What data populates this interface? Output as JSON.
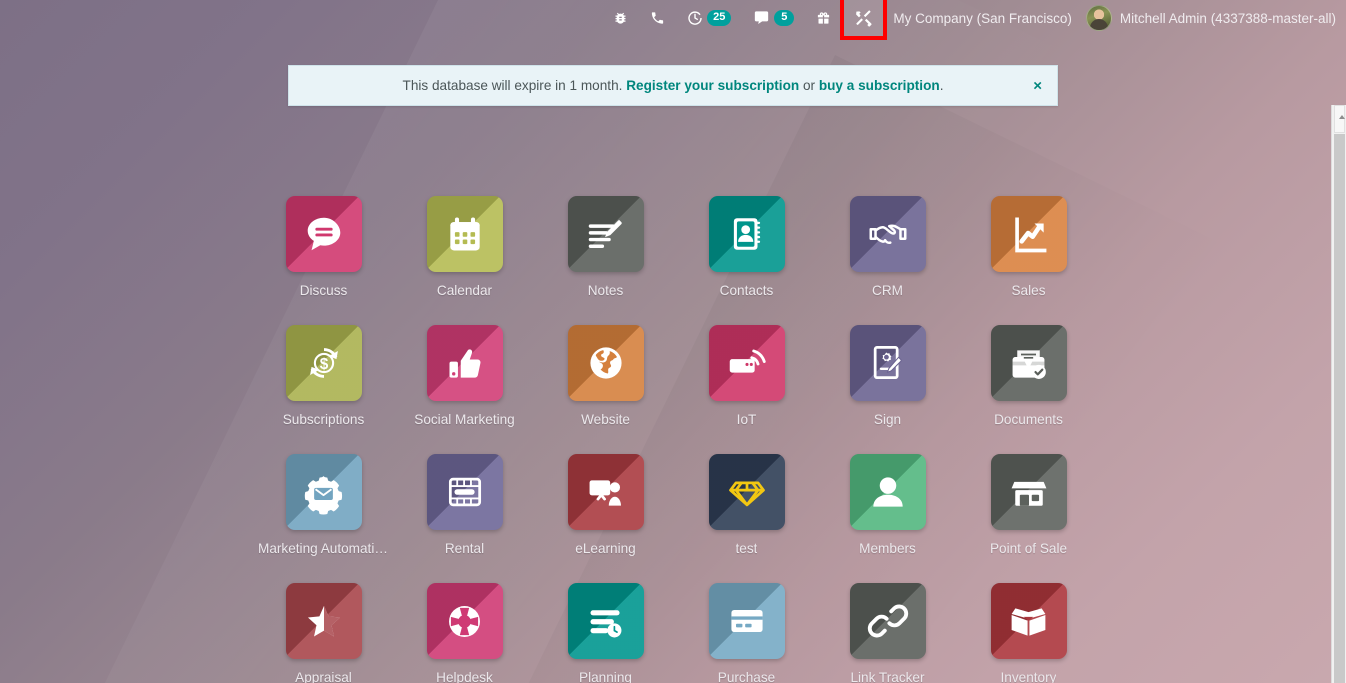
{
  "topbar": {
    "systray": [
      {
        "name": "bug-icon",
        "icon": "bug",
        "badge": null
      },
      {
        "name": "phone-icon",
        "icon": "phone",
        "badge": null
      },
      {
        "name": "activities-icon",
        "icon": "clock",
        "badge": "25"
      },
      {
        "name": "messages-icon",
        "icon": "comment",
        "badge": "5"
      },
      {
        "name": "gift-icon",
        "icon": "gift",
        "badge": null
      },
      {
        "name": "tools-icon",
        "icon": "tools",
        "badge": null,
        "highlighted": true
      }
    ],
    "company": "My Company (San Francisco)",
    "user": "Mitchell Admin (4337388-master-all)"
  },
  "banner": {
    "lead": "This database will expire in 1 month.",
    "link1": "Register your subscription",
    "middle": " or ",
    "link2": "buy a subscription",
    "tail": ".",
    "close": "×",
    "link_color": "#00867d"
  },
  "apps": [
    {
      "label": "Discuss",
      "icon": "discuss",
      "color": "#d0386e"
    },
    {
      "label": "Calendar",
      "icon": "calendar",
      "color": "#b4bb52"
    },
    {
      "label": "Notes",
      "icon": "notes",
      "color": "#5a5f5a"
    },
    {
      "label": "Contacts",
      "icon": "contacts",
      "color": "#00958c"
    },
    {
      "label": "CRM",
      "icon": "crm",
      "color": "#6b6391"
    },
    {
      "label": "Sales",
      "icon": "sales",
      "color": "#d9813f"
    },
    {
      "label": "Subscriptions",
      "icon": "subscriptions",
      "color": "#aab14f"
    },
    {
      "label": "Social Marketing",
      "icon": "social",
      "color": "#d13d76"
    },
    {
      "label": "Website",
      "icon": "website",
      "color": "#d5803d"
    },
    {
      "label": "IoT",
      "icon": "iot",
      "color": "#cf3668"
    },
    {
      "label": "Sign",
      "icon": "sign",
      "color": "#6b6391"
    },
    {
      "label": "Documents",
      "icon": "documents",
      "color": "#5a5f5a"
    },
    {
      "label": "Marketing Automation",
      "icon": "marketing-automation",
      "color": "#72a4c0"
    },
    {
      "label": "Rental",
      "icon": "rental",
      "color": "#6d6697"
    },
    {
      "label": "eLearning",
      "icon": "elearning",
      "color": "#a93a40"
    },
    {
      "label": "test",
      "icon": "diamond",
      "color": "#2e3d55"
    },
    {
      "label": "Members",
      "icon": "members",
      "color": "#52b77f"
    },
    {
      "label": "Point of Sale",
      "icon": "pos",
      "color": "#5d625d"
    },
    {
      "label": "Appraisal",
      "icon": "appraisal",
      "color": "#a8454b"
    },
    {
      "label": "Helpdesk",
      "icon": "helpdesk",
      "color": "#cf3a74"
    },
    {
      "label": "Planning",
      "icon": "planning",
      "color": "#00968e"
    },
    {
      "label": "Purchase",
      "icon": "purchase",
      "color": "#76a9c4"
    },
    {
      "label": "Link Tracker",
      "icon": "link",
      "color": "#5a5f5a"
    },
    {
      "label": "Inventory",
      "icon": "inventory",
      "color": "#ab363c"
    }
  ]
}
